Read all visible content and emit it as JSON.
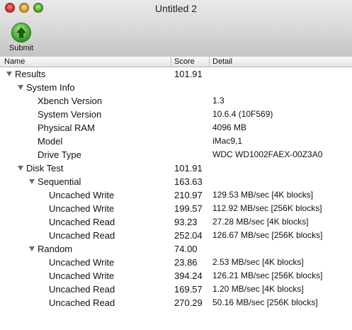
{
  "window": {
    "title": "Untitled 2"
  },
  "toolbar": {
    "submit_label": "Submit"
  },
  "columns": {
    "name": "Name",
    "score": "Score",
    "detail": "Detail"
  },
  "rows": [
    {
      "name": "Results",
      "score": "101.91",
      "detail": "",
      "level": 0,
      "expandable": true
    },
    {
      "name": "System Info",
      "score": "",
      "detail": "",
      "level": 1,
      "expandable": true
    },
    {
      "name": "Xbench Version",
      "score": "",
      "detail": "1.3",
      "level": 2,
      "expandable": false
    },
    {
      "name": "System Version",
      "score": "",
      "detail": "10.6.4 (10F569)",
      "level": 2,
      "expandable": false
    },
    {
      "name": "Physical RAM",
      "score": "",
      "detail": "4096 MB",
      "level": 2,
      "expandable": false
    },
    {
      "name": "Model",
      "score": "",
      "detail": "iMac9,1",
      "level": 2,
      "expandable": false
    },
    {
      "name": "Drive Type",
      "score": "",
      "detail": "WDC WD1002FAEX-00Z3A0",
      "level": 2,
      "expandable": false
    },
    {
      "name": "Disk Test",
      "score": "101.91",
      "detail": "",
      "level": 1,
      "expandable": true
    },
    {
      "name": "Sequential",
      "score": "163.63",
      "detail": "",
      "level": 2,
      "expandable": true
    },
    {
      "name": "Uncached Write",
      "score": "210.97",
      "detail": "129.53 MB/sec [4K blocks]",
      "level": 3,
      "expandable": false
    },
    {
      "name": "Uncached Write",
      "score": "199.57",
      "detail": "112.92 MB/sec [256K blocks]",
      "level": 3,
      "expandable": false
    },
    {
      "name": "Uncached Read",
      "score": "93.23",
      "detail": "27.28 MB/sec [4K blocks]",
      "level": 3,
      "expandable": false
    },
    {
      "name": "Uncached Read",
      "score": "252.04",
      "detail": "126.67 MB/sec [256K blocks]",
      "level": 3,
      "expandable": false
    },
    {
      "name": "Random",
      "score": "74.00",
      "detail": "",
      "level": 2,
      "expandable": true
    },
    {
      "name": "Uncached Write",
      "score": "23.86",
      "detail": "2.53 MB/sec [4K blocks]",
      "level": 3,
      "expandable": false
    },
    {
      "name": "Uncached Write",
      "score": "394.24",
      "detail": "126.21 MB/sec [256K blocks]",
      "level": 3,
      "expandable": false
    },
    {
      "name": "Uncached Read",
      "score": "169.57",
      "detail": "1.20 MB/sec [4K blocks]",
      "level": 3,
      "expandable": false
    },
    {
      "name": "Uncached Read",
      "score": "270.29",
      "detail": "50.16 MB/sec [256K blocks]",
      "level": 3,
      "expandable": false
    }
  ]
}
